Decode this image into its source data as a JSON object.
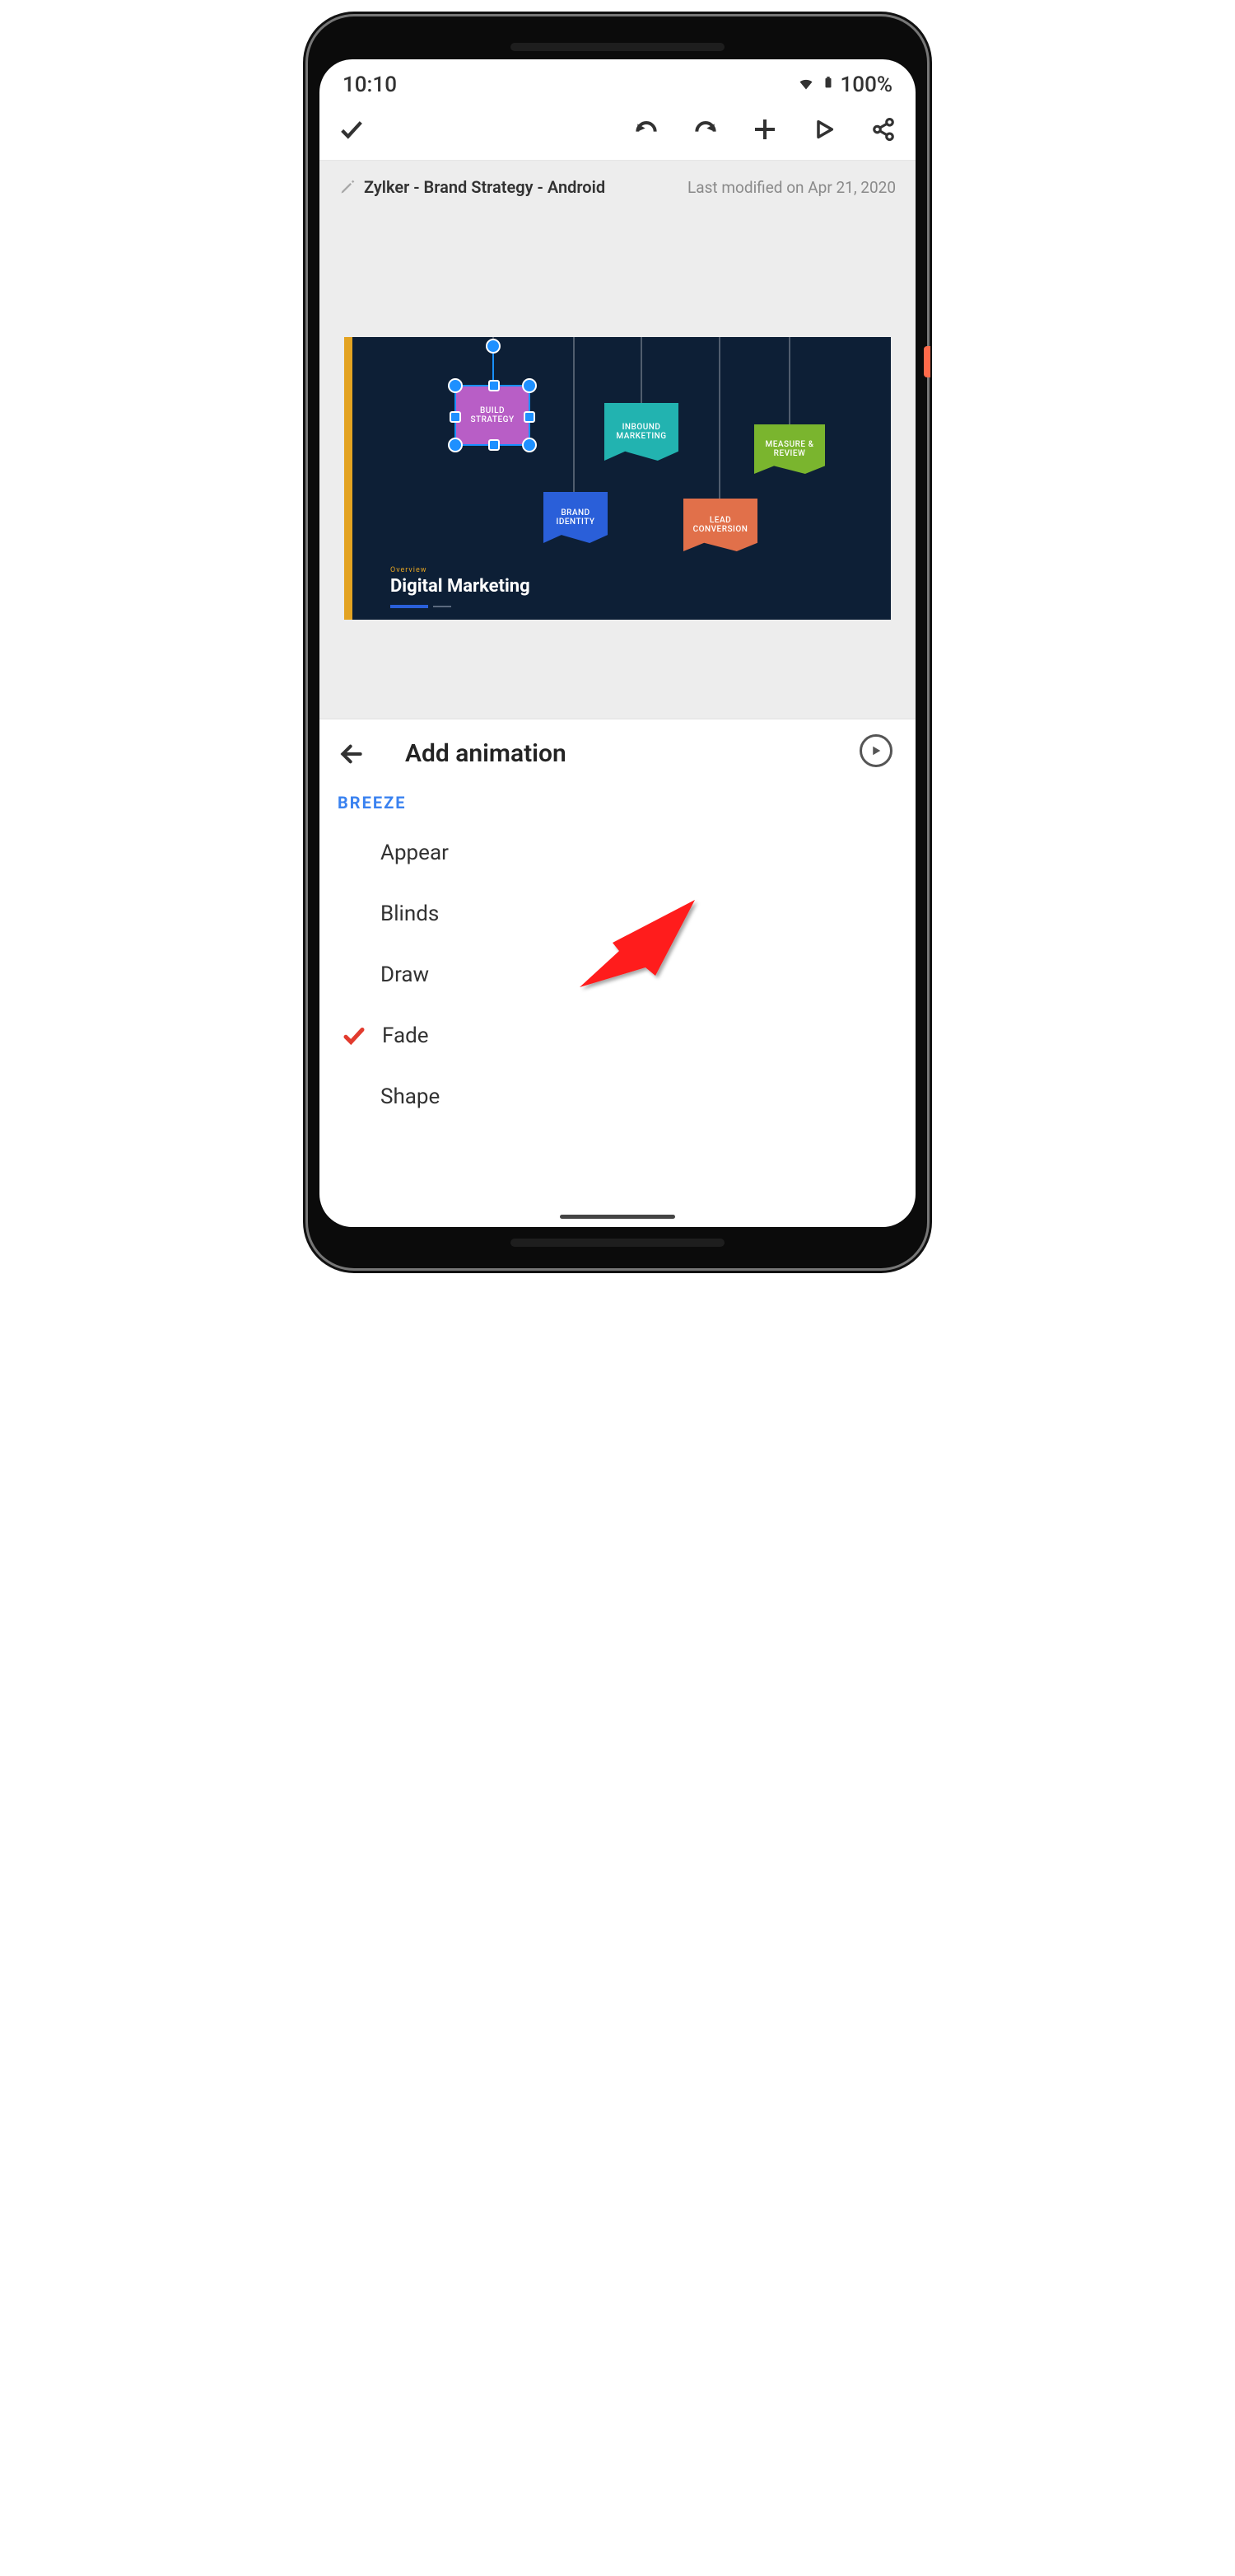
{
  "status": {
    "time": "10:10",
    "battery": "100%"
  },
  "document": {
    "title": "Zylker - Brand Strategy - Android",
    "last_modified": "Last modified on Apr 21, 2020"
  },
  "slide": {
    "overview_label": "Overview",
    "title": "Digital Marketing",
    "shapes": {
      "build_l1": "BUILD",
      "build_l2": "STRATEGY",
      "inbound_l1": "INBOUND",
      "inbound_l2": "MARKETING",
      "measure_l1": "MEASURE &",
      "measure_l2": "REVIEW",
      "brand_l1": "BRAND",
      "brand_l2": "IDENTITY",
      "lead_l1": "LEAD",
      "lead_l2": "CONVERSION"
    }
  },
  "panel": {
    "title": "Add animation",
    "category": "BREEZE",
    "items": [
      {
        "label": "Appear",
        "selected": false
      },
      {
        "label": "Blinds",
        "selected": false
      },
      {
        "label": "Draw",
        "selected": false
      },
      {
        "label": "Fade",
        "selected": true
      },
      {
        "label": "Shape",
        "selected": false
      }
    ]
  }
}
